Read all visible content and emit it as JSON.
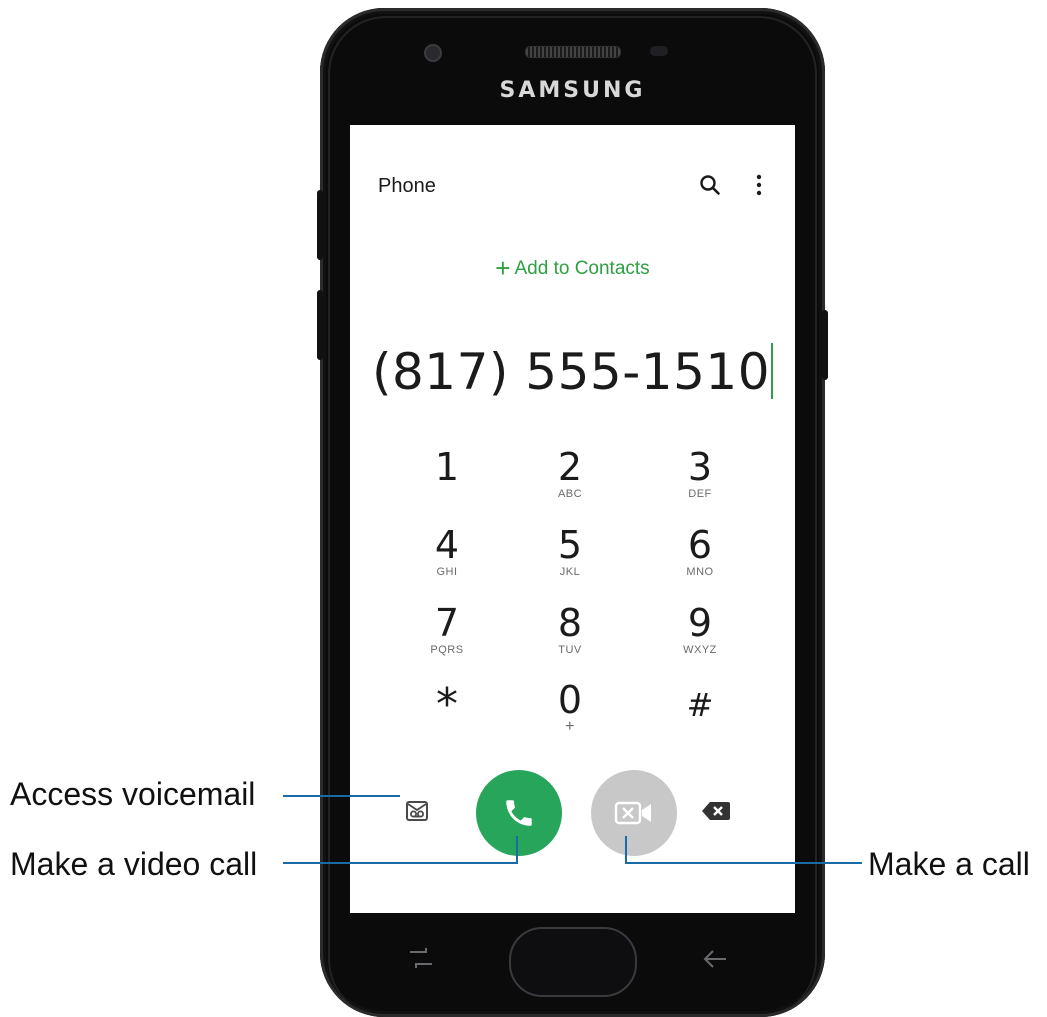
{
  "device": {
    "brand": "SAMSUNG"
  },
  "header": {
    "title": "Phone",
    "search_icon": "search-icon",
    "more_icon": "more-options-icon"
  },
  "add_contacts": {
    "label": "Add to Contacts",
    "plus": "+"
  },
  "dialed_number": "(817) 555-1510",
  "keypad": [
    {
      "digit": "1",
      "letters": ""
    },
    {
      "digit": "2",
      "letters": "ABC"
    },
    {
      "digit": "3",
      "letters": "DEF"
    },
    {
      "digit": "4",
      "letters": "GHI"
    },
    {
      "digit": "5",
      "letters": "JKL"
    },
    {
      "digit": "6",
      "letters": "MNO"
    },
    {
      "digit": "7",
      "letters": "PQRS"
    },
    {
      "digit": "8",
      "letters": "TUV"
    },
    {
      "digit": "9",
      "letters": "WXYZ"
    },
    {
      "digit": "*",
      "letters": ""
    },
    {
      "digit": "0",
      "letters": "+"
    },
    {
      "digit": "#",
      "letters": ""
    }
  ],
  "actions": {
    "voicemail_icon": "voicemail-icon",
    "call_icon": "phone-icon",
    "video_icon": "video-call-icon",
    "backspace_icon": "backspace-icon"
  },
  "callouts": {
    "voicemail": "Access voicemail",
    "video_call": "Make a video call",
    "call": "Make a call"
  },
  "colors": {
    "accent_green": "#2ea043",
    "call_button": "#27a55b",
    "video_button_disabled": "#c8c8c8",
    "callout_line": "#1a6aa8"
  }
}
